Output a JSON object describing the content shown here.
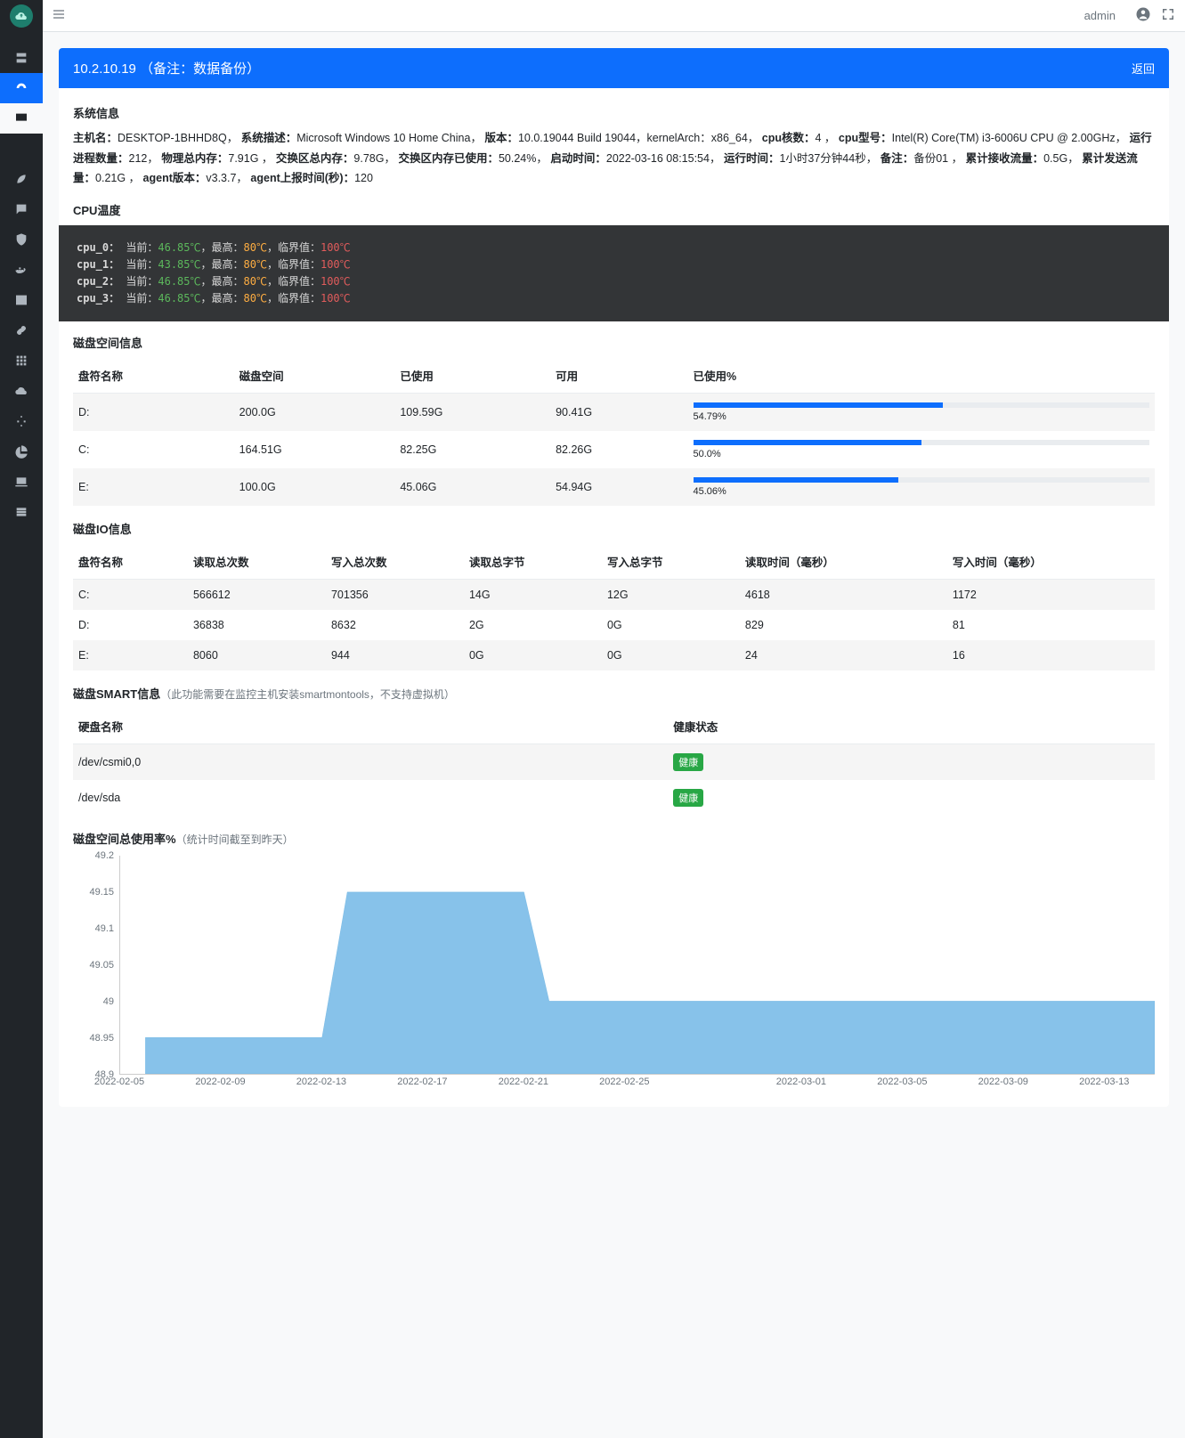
{
  "topbar": {
    "user": "admin"
  },
  "header": {
    "title": "10.2.10.19 （备注：数据备份）",
    "back": "返回"
  },
  "section_titles": {
    "sysinfo": "系统信息",
    "cputemp": "CPU温度",
    "disk_space": "磁盘空间信息",
    "disk_io": "磁盘IO信息",
    "smart": "磁盘SMART信息",
    "smart_note": "（此功能需要在监控主机安装smartmontools，不支持虚拟机）",
    "chart": "磁盘空间总使用率%",
    "chart_note": "（统计时间截至到昨天）"
  },
  "sysinfo": {
    "hostname_l": "主机名：",
    "hostname": "DESKTOP-1BHHD8Q，",
    "desc_l": "系统描述：",
    "desc": "Microsoft Windows 10 Home China，",
    "version_l": "版本：",
    "version": "10.0.19044 Build 19044，kernelArch：x86_64，",
    "cores_l": "cpu核数：",
    "cores": "4 ，",
    "model_l": "cpu型号：",
    "model": "Intel(R) Core(TM) i3-6006U CPU @ 2.00GHz，",
    "procs_l": "运行进程数量：",
    "procs": "212，",
    "mem_l": "物理总内存：",
    "mem": "7.91G ，",
    "swap_l": "交换区总内存：",
    "swap": "9.78G，",
    "swapused_l": "交换区内存已使用：",
    "swapused": "50.24%，",
    "boot_l": "启动时间：",
    "boot": "2022-03-16 08:15:54，",
    "uptime_l": "运行时间：",
    "uptime": "1小时37分钟44秒，",
    "remark_l": "备注：",
    "remark": "备份01 ，",
    "recv_l": "累计接收流量：",
    "recv": "0.5G，",
    "send_l": "累计发送流量：",
    "send": "0.21G ，",
    "agent_l": "agent版本：",
    "agent": "v3.3.7，",
    "report_l": "agent上报时间(秒)：",
    "report": "120"
  },
  "cputemp": {
    "rows": [
      {
        "name": "cpu_0：",
        "cur_l": "当前：",
        "cur": "46.85℃",
        "max_l": "，最高：",
        "max": "80℃",
        "crit_l": "，临界值：",
        "crit": "100℃"
      },
      {
        "name": "cpu_1：",
        "cur_l": "当前：",
        "cur": "43.85℃",
        "max_l": "，最高：",
        "max": "80℃",
        "crit_l": "，临界值：",
        "crit": "100℃"
      },
      {
        "name": "cpu_2：",
        "cur_l": "当前：",
        "cur": "46.85℃",
        "max_l": "，最高：",
        "max": "80℃",
        "crit_l": "，临界值：",
        "crit": "100℃"
      },
      {
        "name": "cpu_3：",
        "cur_l": "当前：",
        "cur": "46.85℃",
        "max_l": "，最高：",
        "max": "80℃",
        "crit_l": "，临界值：",
        "crit": "100℃"
      }
    ]
  },
  "disk_space": {
    "headers": [
      "盘符名称",
      "磁盘空间",
      "已使用",
      "可用",
      "已使用%"
    ],
    "rows": [
      {
        "name": "D:",
        "total": "200.0G",
        "used": "109.59G",
        "free": "90.41G",
        "pct": "54.79%",
        "pct_num": 54.79
      },
      {
        "name": "C:",
        "total": "164.51G",
        "used": "82.25G",
        "free": "82.26G",
        "pct": "50.0%",
        "pct_num": 50.0
      },
      {
        "name": "E:",
        "total": "100.0G",
        "used": "45.06G",
        "free": "54.94G",
        "pct": "45.06%",
        "pct_num": 45.06
      }
    ]
  },
  "disk_io": {
    "headers": [
      "盘符名称",
      "读取总次数",
      "写入总次数",
      "读取总字节",
      "写入总字节",
      "读取时间（毫秒）",
      "写入时间（毫秒）"
    ],
    "rows": [
      {
        "c0": "C:",
        "c1": "566612",
        "c2": "701356",
        "c3": "14G",
        "c4": "12G",
        "c5": "4618",
        "c6": "1172"
      },
      {
        "c0": "D:",
        "c1": "36838",
        "c2": "8632",
        "c3": "2G",
        "c4": "0G",
        "c5": "829",
        "c6": "81"
      },
      {
        "c0": "E:",
        "c1": "8060",
        "c2": "944",
        "c3": "0G",
        "c4": "0G",
        "c5": "24",
        "c6": "16"
      }
    ]
  },
  "smart": {
    "headers": [
      "硬盘名称",
      "健康状态"
    ],
    "rows": [
      {
        "name": "/dev/csmi0,0",
        "status": "健康"
      },
      {
        "name": "/dev/sda",
        "status": "健康"
      }
    ]
  },
  "chart_data": {
    "type": "area",
    "title": "磁盘空间总使用率%",
    "ylabel": "",
    "xlabel": "",
    "ylim": [
      48.9,
      49.2
    ],
    "yticks": [
      "49.2",
      "49.15",
      "49.1",
      "49.05",
      "49",
      "48.95",
      "48.9"
    ],
    "xticks": [
      "2022-02-05",
      "2022-02-09",
      "2022-02-13",
      "2022-02-17",
      "2022-02-21",
      "2022-02-25",
      "2022-03-01",
      "2022-03-05",
      "2022-03-09",
      "2022-03-13"
    ],
    "x_range": [
      "2022-02-05",
      "2022-03-15"
    ],
    "series": [
      {
        "name": "使用率%",
        "color": "#87c2ea",
        "points": [
          {
            "x": "2022-02-06",
            "y": 48.95
          },
          {
            "x": "2022-02-13",
            "y": 48.95
          },
          {
            "x": "2022-02-14",
            "y": 49.15
          },
          {
            "x": "2022-02-21",
            "y": 49.15
          },
          {
            "x": "2022-02-22",
            "y": 49.0
          },
          {
            "x": "2022-03-15",
            "y": 49.0
          }
        ]
      }
    ]
  }
}
